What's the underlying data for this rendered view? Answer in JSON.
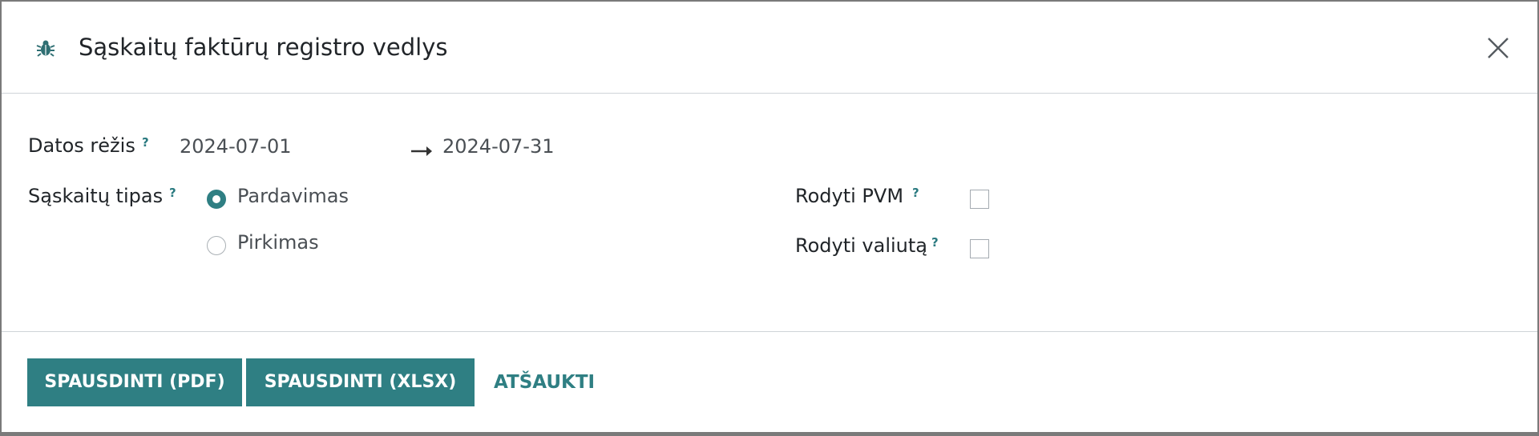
{
  "dialog": {
    "title": "Sąskaitų faktūrų registro vedlys",
    "icon": "bug-icon",
    "close_icon": "close-icon"
  },
  "fields": {
    "date_range": {
      "label": "Datos rėžis",
      "help": "?",
      "start": "2024-07-01",
      "end": "2024-07-31"
    },
    "invoice_type": {
      "label": "Sąskaitų tipas",
      "help": "?",
      "options": [
        {
          "label": "Pardavimas",
          "selected": true
        },
        {
          "label": "Pirkimas",
          "selected": false
        }
      ]
    },
    "show_vat": {
      "label": "Rodyti PVM",
      "help": "?",
      "checked": false
    },
    "show_currency": {
      "label": "Rodyti valiutą",
      "help": "?",
      "checked": false
    }
  },
  "footer": {
    "print_pdf": "SPAUSDINTI (PDF)",
    "print_xlsx": "SPAUSDINTI (XLSX)",
    "cancel": "ATŠAUKTI"
  },
  "colors": {
    "accent": "#2f7f83",
    "text": "#212529",
    "muted": "#4a4f54",
    "border": "#cfd4d8"
  }
}
